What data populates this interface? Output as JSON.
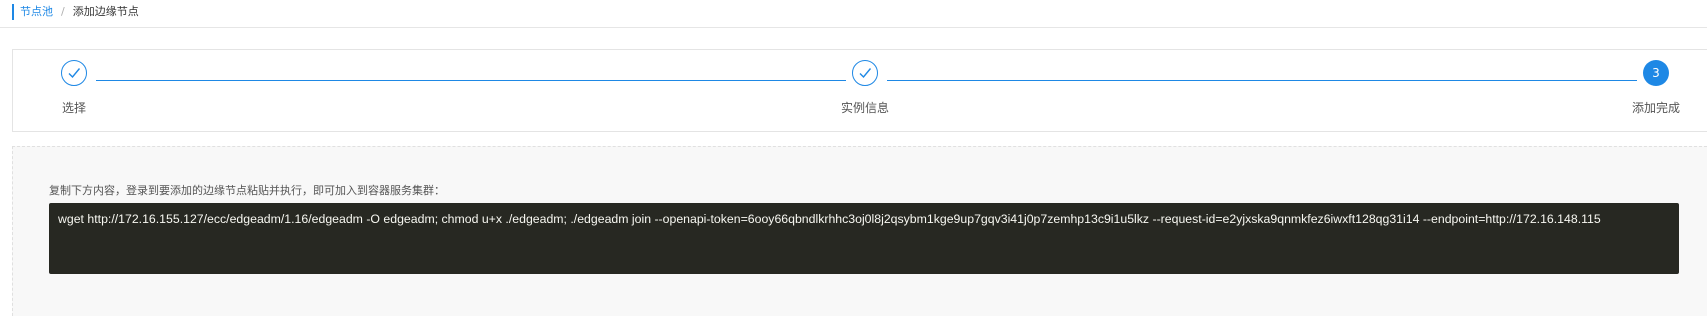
{
  "breadcrumb": {
    "parent": "节点池",
    "separator": "/",
    "current": "添加边缘节点"
  },
  "steps": [
    {
      "label": "选择",
      "status": "done",
      "icon": "check-icon"
    },
    {
      "label": "实例信息",
      "status": "done",
      "icon": "check-icon"
    },
    {
      "label": "添加完成",
      "status": "active",
      "number": "3"
    }
  ],
  "instructions": {
    "hint": "复制下方内容，登录到要添加的边缘节点粘贴并执行，即可加入到容器服务集群：",
    "command": "wget http://172.16.155.127/ecc/edgeadm/1.16/edgeadm -O edgeadm; chmod u+x ./edgeadm; ./edgeadm join --openapi-token=6ooy66qbndlkrhhc3oj0l8j2qsybm1kge9up7gqv3i41j0p7zemhp13c9i1u5lkz --request-id=e2yjxska9qnmkfez6iwxft128qg31i14 --endpoint=http://172.16.148.115"
  },
  "colors": {
    "accent": "#1e88e5",
    "code_background": "#272822",
    "code_text": "#f8f8f2"
  }
}
